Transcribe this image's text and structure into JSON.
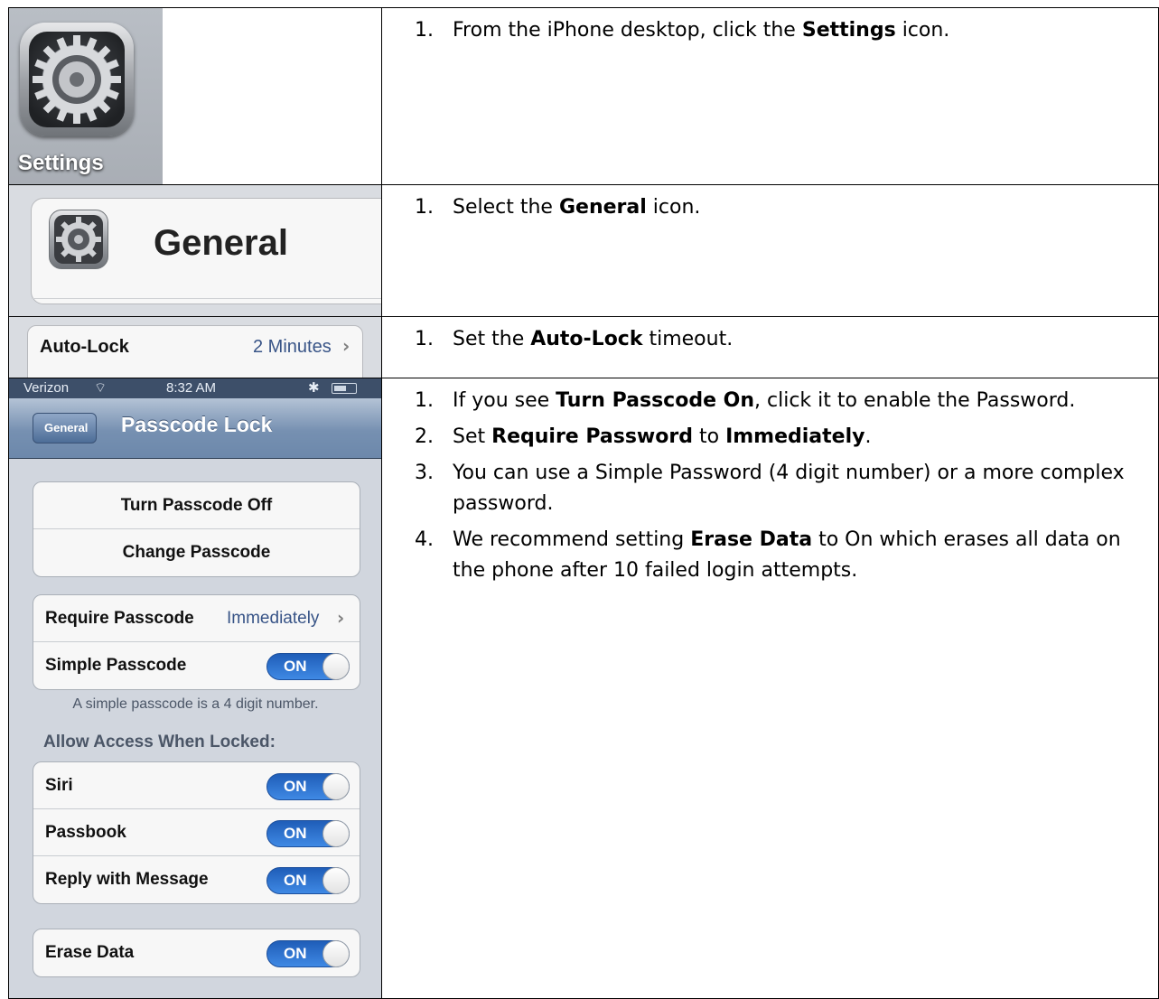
{
  "rows": [
    {
      "steps": [
        {
          "parts": [
            "From the iPhone desktop, click the ",
            "Settings",
            " icon."
          ]
        }
      ]
    },
    {
      "steps": [
        {
          "parts": [
            "Select the ",
            "General",
            " icon."
          ]
        }
      ]
    },
    {
      "steps": [
        {
          "parts": [
            "Set the ",
            "Auto-Lock",
            " timeout."
          ]
        }
      ]
    },
    {
      "steps": [
        {
          "parts": [
            "If you see ",
            "Turn Passcode On",
            ", click it to enable the Password."
          ]
        },
        {
          "parts": [
            "Set ",
            "Require Password",
            " to ",
            "Immediately",
            "."
          ]
        },
        {
          "parts": [
            "You can use a Simple Password (4 digit number) or a more complex password."
          ]
        },
        {
          "parts": [
            "We recommend setting ",
            "Erase Data",
            " to On which erases all data on the phone after 10 failed login attempts."
          ]
        }
      ]
    }
  ],
  "settings_icon": {
    "label": "Settings",
    "icon": "gear-icon"
  },
  "general": {
    "title": "General",
    "icon": "gear-icon"
  },
  "autolock": {
    "label": "Auto-Lock",
    "value": "2 Minutes",
    "chevron": "›"
  },
  "phone": {
    "status": {
      "carrier": "Verizon",
      "wifi": "⌔",
      "time": "8:32 AM",
      "bluetooth": "✱"
    },
    "back_label": "General",
    "title": "Passcode Lock",
    "passcode_buttons": [
      "Turn Passcode Off",
      "Change Passcode"
    ],
    "require": {
      "label": "Require Passcode",
      "value": "Immediately",
      "chevron": "›"
    },
    "simple": {
      "label": "Simple Passcode",
      "state": "ON"
    },
    "simple_note": "A simple passcode is a 4 digit number.",
    "allow_header": "Allow Access When Locked:",
    "allow_items": [
      {
        "label": "Siri",
        "state": "ON"
      },
      {
        "label": "Passbook",
        "state": "ON"
      },
      {
        "label": "Reply with Message",
        "state": "ON"
      }
    ],
    "erase": {
      "label": "Erase Data",
      "state": "ON"
    },
    "accent_blue": "#3f89e4",
    "nav_color": "#6c88ab"
  }
}
